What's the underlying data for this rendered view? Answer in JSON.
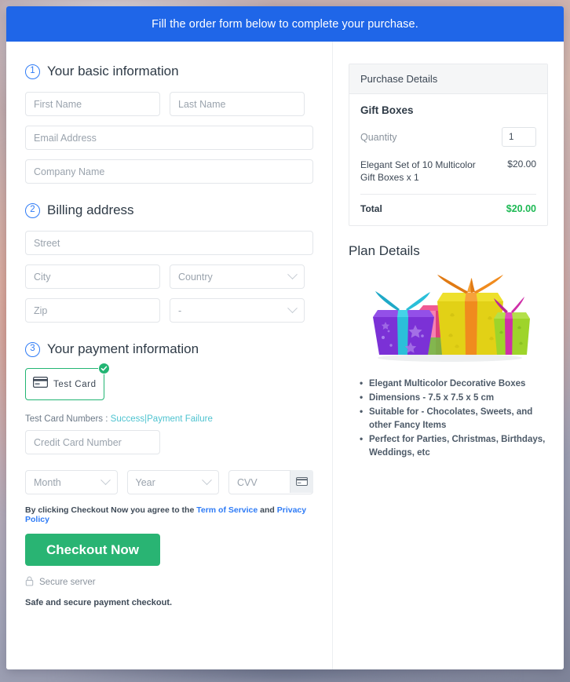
{
  "banner": {
    "message": "Fill the order form below to complete your purchase."
  },
  "sections": {
    "basic": {
      "number": "1",
      "title": "Your basic information",
      "fields": {
        "first_name": "First Name",
        "last_name": "Last Name",
        "email": "Email Address",
        "company": "Company Name"
      }
    },
    "billing": {
      "number": "2",
      "title": "Billing address",
      "fields": {
        "street": "Street",
        "city": "City",
        "country": "Country",
        "zip": "Zip",
        "state": "-"
      }
    },
    "payment": {
      "number": "3",
      "title": "Your payment information",
      "method_label": "Test Card",
      "method_icon": "credit-card-icon",
      "selected_icon": "check-circle-icon",
      "test_numbers_label": "Test Card Numbers :",
      "test_success_link": "Success",
      "test_separator": "|",
      "test_failure_link": "Payment Failure",
      "card_number": "Credit Card Number",
      "month": "Month",
      "year": "Year",
      "cvv": "CVV",
      "cvv_icon": "credit-card-icon"
    }
  },
  "footer": {
    "terms_prefix": "By clicking Checkout Now you agree to the",
    "terms_link": "Term of Service",
    "terms_and": "and",
    "privacy_link": "Privacy Policy",
    "checkout_button": "Checkout Now",
    "secure_icon": "lock-icon",
    "secure_text": "Secure server",
    "safe_note": "Safe and secure payment checkout."
  },
  "purchase": {
    "header": "Purchase Details",
    "product_title": "Gift Boxes",
    "quantity_label": "Quantity",
    "quantity_value": "1",
    "item_name": "Elegant Set of 10 Multicolor Gift Boxes x 1",
    "item_price": "$20.00",
    "total_label": "Total",
    "total_value": "$20.00"
  },
  "plan": {
    "title": "Plan Details",
    "image_alt": "gift-boxes-image",
    "features": [
      "Elegant Multicolor Decorative Boxes",
      "Dimensions - 7.5 x 7.5 x 5 cm",
      "Suitable for - Chocolates, Sweets, and other Fancy Items",
      "Perfect for Parties, Christmas, Birthdays, Weddings, etc"
    ]
  },
  "colors": {
    "banner_blue": "#1f66e8",
    "accent_blue": "#2e7bf6",
    "success_green": "#22b573",
    "button_green": "#29b473",
    "total_green": "#1db954",
    "link_teal": "#4ec3d0"
  }
}
